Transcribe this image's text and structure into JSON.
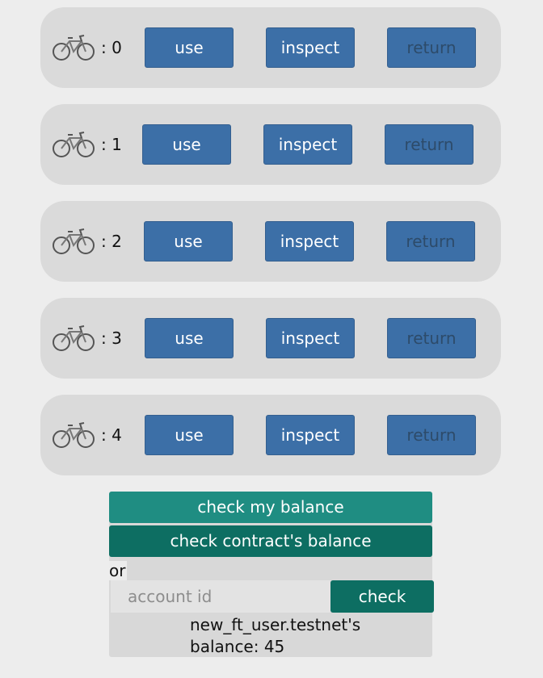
{
  "bikes": [
    {
      "number": ": 0",
      "use": "use",
      "inspect": "inspect",
      "return": "return"
    },
    {
      "number": ": 1",
      "use": "use",
      "inspect": "inspect",
      "return": "return"
    },
    {
      "number": ": 2",
      "use": "use",
      "inspect": "inspect",
      "return": "return"
    },
    {
      "number": ": 3",
      "use": "use",
      "inspect": "inspect",
      "return": "return"
    },
    {
      "number": ": 4",
      "use": "use",
      "inspect": "inspect",
      "return": "return"
    }
  ],
  "icon": "bicycle-icon",
  "balance": {
    "check_my_balance": "check my balance",
    "check_contract_balance": "check contract's balance",
    "or_label": "or",
    "account_placeholder": "account id",
    "account_value": "",
    "check_label": "check",
    "result_line1": "new_ft_user.testnet's",
    "result_line2": "balance: 45"
  },
  "colors": {
    "page_bg": "#ededed",
    "row_bg": "#dadada",
    "button_blue": "#3c6fa7",
    "teal_light": "#1f8d82",
    "teal_dark": "#0d6e62"
  }
}
